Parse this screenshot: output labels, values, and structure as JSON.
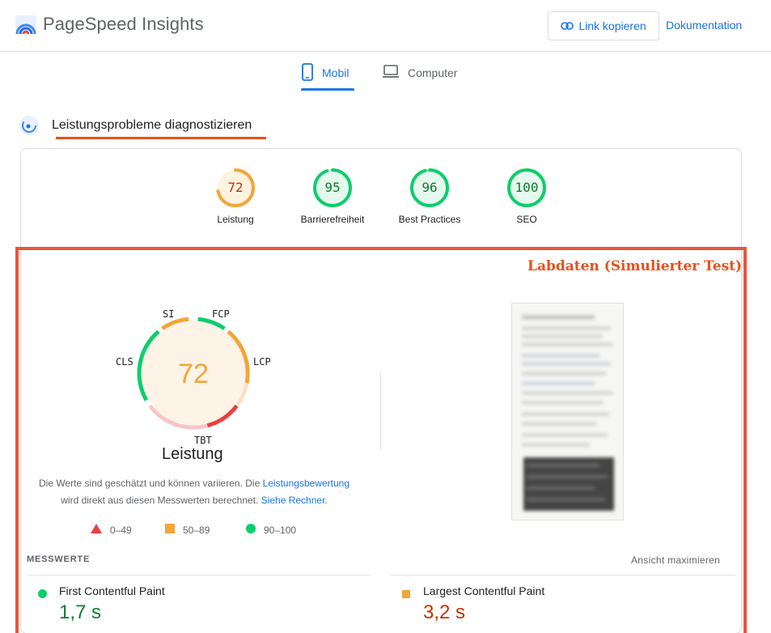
{
  "app": {
    "title": "PageSpeed Insights",
    "logo_icon": "pagespeed-logo-icon"
  },
  "header": {
    "copy_link_label": "Link kopieren",
    "docs_label": "Dokumentation"
  },
  "tabs": [
    {
      "label": "Mobil",
      "icon": "smartphone-icon",
      "active": true
    },
    {
      "label": "Computer",
      "icon": "laptop-icon",
      "active": false
    }
  ],
  "section": {
    "title": "Leistungsprobleme diagnostizieren"
  },
  "categories": [
    {
      "score": "72",
      "label": "Leistung",
      "color": "#f4a53b",
      "fraction": 0.72
    },
    {
      "score": "95",
      "label": "Barrierefreiheit",
      "color": "#0cce6b",
      "fraction": 0.95
    },
    {
      "score": "96",
      "label": "Best Practices",
      "color": "#0cce6b",
      "fraction": 0.96
    },
    {
      "score": "100",
      "label": "SEO",
      "color": "#0cce6b",
      "fraction": 1.0
    }
  ],
  "annotation": {
    "label": "Labdaten (Simulierter Test)"
  },
  "gauge": {
    "score": "72",
    "title": "Leistung",
    "segments": [
      "SI",
      "FCP",
      "LCP",
      "TBT",
      "CLS"
    ]
  },
  "description": {
    "part1": "Die Werte sind geschätzt und können variieren. Die ",
    "link1": "Leistungsbewertung",
    "part2": "wird direkt aus diesen Messwerten berechnet. ",
    "link2": "Siehe Rechner",
    "part3": "."
  },
  "legend": [
    {
      "range": "0–49",
      "shape": "triangle",
      "color": "#eb3f3f"
    },
    {
      "range": "50–89",
      "shape": "square",
      "color": "#f4a53b"
    },
    {
      "range": "90–100",
      "shape": "circle",
      "color": "#0cce6b"
    }
  ],
  "metrics": {
    "header": "MESSWERTE",
    "expand_label": "Ansicht maximieren",
    "items": [
      {
        "name": "First Contentful Paint",
        "value": "1,7 s",
        "status": "good"
      },
      {
        "name": "Largest Contentful Paint",
        "value": "3,2 s",
        "status": "average"
      }
    ]
  }
}
